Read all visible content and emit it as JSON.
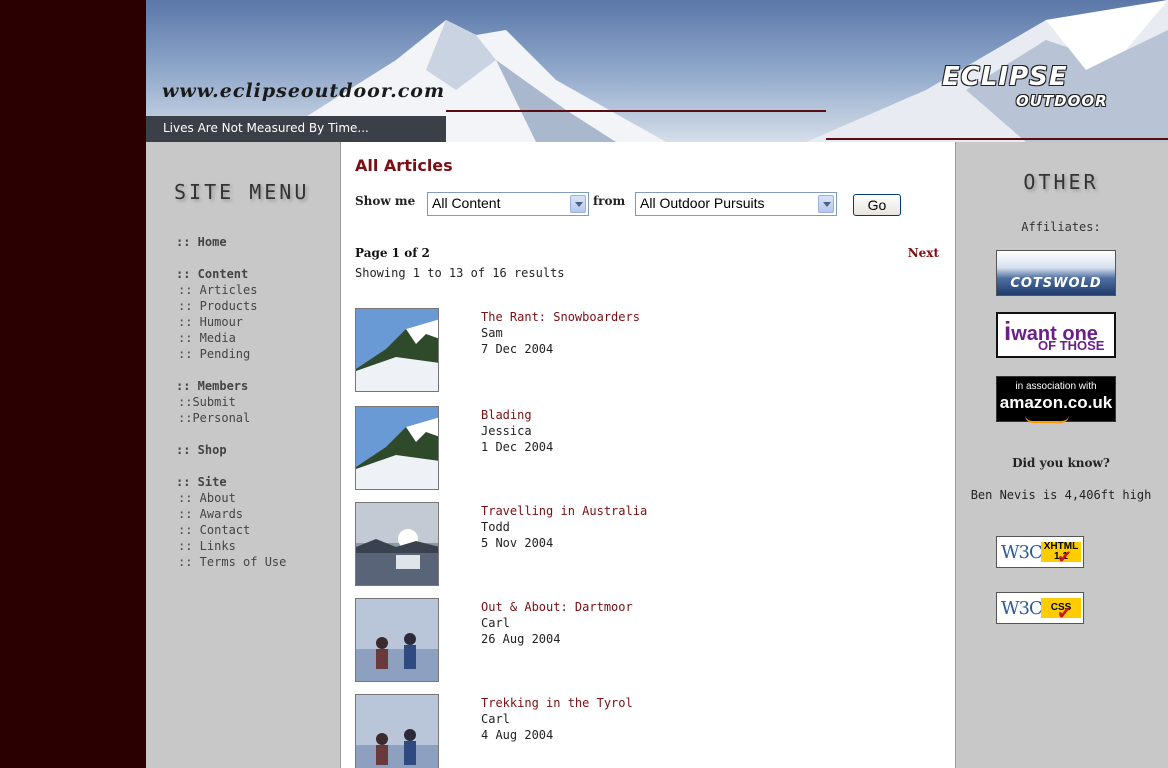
{
  "header": {
    "site_url": "www.eclipseoutdoor.com",
    "tagline": "Lives Are Not Measured By Time...",
    "logo_line1": "ECLIPSE",
    "logo_line2": "OUTDOOR"
  },
  "sidebar": {
    "title": "SITE MENU",
    "groups": [
      {
        "label": ":: Home",
        "items": []
      },
      {
        "label": ":: Content",
        "items": [
          ":: Articles",
          ":: Products",
          ":: Humour",
          ":: Media",
          ":: Pending"
        ]
      },
      {
        "label": ":: Members",
        "items": [
          "::Submit",
          "::Personal"
        ]
      },
      {
        "label": ":: Shop",
        "items": []
      },
      {
        "label": ":: Site",
        "items": [
          ":: About",
          ":: Awards",
          ":: Contact",
          ":: Links",
          ":: Terms of Use"
        ]
      }
    ]
  },
  "main": {
    "title": "All Articles",
    "show_me_label": "Show me",
    "content_select": "All Content",
    "from_label": "from",
    "pursuits_select": "All Outdoor Pursuits",
    "go_label": "Go",
    "page_info": "Page 1 of 2",
    "next_label": "Next",
    "showing": "Showing 1 to 13 of 16 results",
    "articles": [
      {
        "title": "The Rant: Snowboarders",
        "author": "Sam",
        "date": "7 Dec 2004",
        "thumb": "snow-mountain"
      },
      {
        "title": "Blading",
        "author": "Jessica",
        "date": "1 Dec 2004",
        "thumb": "snow-mountain"
      },
      {
        "title": "Travelling in Australia",
        "author": "Todd",
        "date": "5 Nov 2004",
        "thumb": "lake-sunset"
      },
      {
        "title": "Out & About: Dartmoor",
        "author": "Carl",
        "date": "26 Aug 2004",
        "thumb": "hikers"
      },
      {
        "title": "Trekking in the Tyrol",
        "author": "Carl",
        "date": "4 Aug 2004",
        "thumb": "hikers"
      }
    ]
  },
  "right": {
    "title": "OTHER",
    "affiliates_label": "Affiliates:",
    "cotswold": "COTSWOLD",
    "iwant_l1": "want one",
    "iwant_l2": "OF THOSE",
    "iwant_i": "i",
    "amazon_l1": "in association with",
    "amazon_l2": "amazon.co.uk",
    "did_you_know": "Did you know?",
    "fact": "Ben Nevis is 4,406ft high",
    "w3c_label": "W3C",
    "xhtml_label": "XHTML 1.1",
    "css_label": "CSS"
  }
}
